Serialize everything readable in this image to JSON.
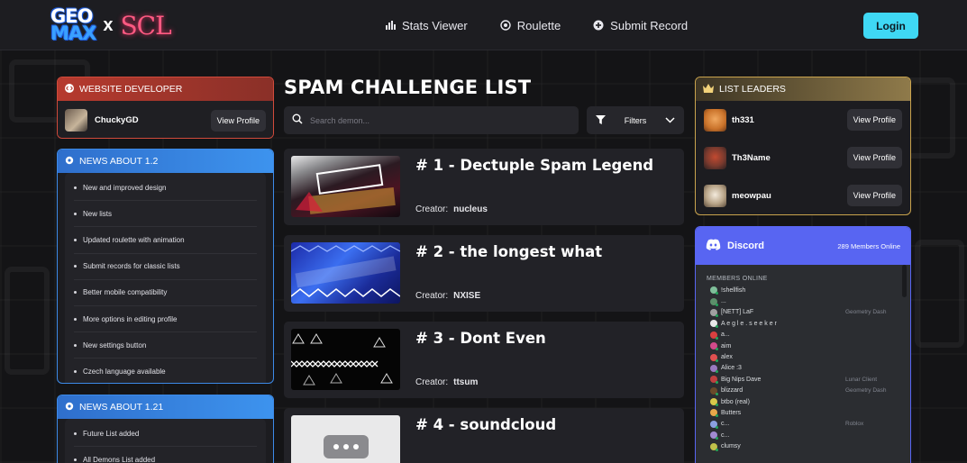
{
  "header": {
    "logo": {
      "geo": "GEO",
      "max": "MAX",
      "x": "x",
      "scl": "SCL"
    },
    "nav": [
      {
        "label": "Stats Viewer",
        "icon": "bar-chart-icon"
      },
      {
        "label": "Roulette",
        "icon": "roulette-icon"
      },
      {
        "label": "Submit Record",
        "icon": "plus-circle-icon"
      }
    ],
    "login_label": "Login"
  },
  "developer": {
    "heading": "WEBSITE DEVELOPER",
    "name": "ChuckyGD",
    "button": "View Profile"
  },
  "news_12": {
    "heading": "NEWS ABOUT 1.2",
    "items": [
      "New and improved design",
      "New lists",
      "Updated roulette with animation",
      "Submit records for classic lists",
      "Better mobile compatibility",
      "More options in editing profile",
      "New settings button",
      "Czech language available"
    ]
  },
  "news_121": {
    "heading": "NEWS ABOUT 1.21",
    "items": [
      "Future List added",
      "All Demons List added"
    ]
  },
  "main": {
    "title": "SPAM CHALLENGE LIST",
    "search_placeholder": "Search demon...",
    "filters_label": "Filters",
    "creator_label": "Creator:",
    "levels": [
      {
        "title": "# 1 - Dectuple Spam Legend",
        "creator": "nucleus"
      },
      {
        "title": "# 2 - the longest what",
        "creator": "NXISE"
      },
      {
        "title": "# 3 - Dont Even",
        "creator": "ttsum"
      },
      {
        "title": "# 4 - soundcloud",
        "creator": ""
      }
    ]
  },
  "leaders": {
    "heading": "LIST LEADERS",
    "button": "View Profile",
    "players": [
      {
        "name": "th331",
        "color": "#c9722a"
      },
      {
        "name": "Th3Name",
        "color": "#7a3a2e"
      },
      {
        "name": "meowpau",
        "color": "#b8a488"
      }
    ]
  },
  "discord": {
    "brand": "Discord",
    "online_count": "289 Members Online",
    "section": "MEMBERS ONLINE",
    "members": [
      {
        "name": "!shellfish",
        "game": "",
        "color": "#7fbf9a"
      },
      {
        "name": "...",
        "game": "",
        "color": "#5c8f6a"
      },
      {
        "name": "[NETT] LaF",
        "game": "Geometry Dash",
        "color": "#a0a0a0"
      },
      {
        "name": "A e g l e . s e e k e r",
        "game": "",
        "color": "#e8e8e8"
      },
      {
        "name": "a...",
        "game": "",
        "color": "#d94040"
      },
      {
        "name": "aim",
        "game": "",
        "color": "#d14a8a"
      },
      {
        "name": "alex",
        "game": "",
        "color": "#e05050"
      },
      {
        "name": "Alice :3",
        "game": "",
        "color": "#9a7ac0"
      },
      {
        "name": "Big Nips Dave",
        "game": "Lunar Client",
        "color": "#c04040"
      },
      {
        "name": "blizzard",
        "game": "Geometry Dash",
        "color": "#6a4a2a"
      },
      {
        "name": "btbo (real)",
        "game": "",
        "color": "#d8c84a"
      },
      {
        "name": "Butters",
        "game": "",
        "color": "#e8a84a"
      },
      {
        "name": "c...",
        "game": "Roblox",
        "color": "#8aa0e0"
      },
      {
        "name": "c...",
        "game": "",
        "color": "#a08ad0"
      },
      {
        "name": "clumsy",
        "game": "",
        "color": "#c0c04a"
      }
    ]
  }
}
